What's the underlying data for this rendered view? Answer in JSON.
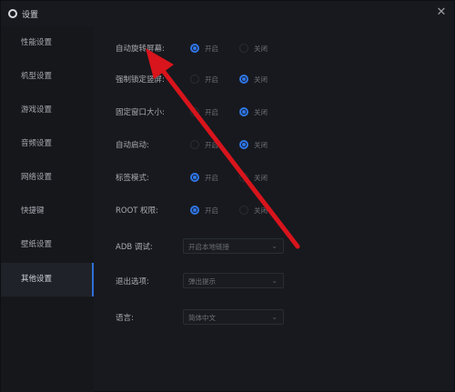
{
  "window": {
    "title": "设置"
  },
  "sidebar": {
    "items": [
      {
        "label": "性能设置"
      },
      {
        "label": "机型设置"
      },
      {
        "label": "游戏设置"
      },
      {
        "label": "音频设置"
      },
      {
        "label": "网络设置"
      },
      {
        "label": "快捷键"
      },
      {
        "label": "壁纸设置"
      },
      {
        "label": "其他设置",
        "active": true
      }
    ]
  },
  "settings": {
    "on_label": "开启",
    "off_label": "关闭",
    "rows": [
      {
        "label": "自动旋转屏幕:",
        "selected": "on"
      },
      {
        "label": "强制锁定竖屏:",
        "selected": "off"
      },
      {
        "label": "固定窗口大小:",
        "selected": "off"
      },
      {
        "label": "自动启动:",
        "selected": "off"
      },
      {
        "label": "标签模式:",
        "selected": "on"
      },
      {
        "label": "ROOT 权限:",
        "selected": "on"
      }
    ],
    "adb": {
      "label": "ADB 调试:",
      "value": "开启本地链接"
    },
    "exit": {
      "label": "退出选项:",
      "value": "弹出提示"
    },
    "language": {
      "label": "语言:",
      "value": "简体中文"
    }
  },
  "colors": {
    "accent": "#2f76e8",
    "arrow": "#d8141c",
    "background": "#17191e"
  },
  "icons": {
    "window": "gear-icon",
    "close": "close-icon",
    "dropdown": "chevron-down-icon"
  }
}
